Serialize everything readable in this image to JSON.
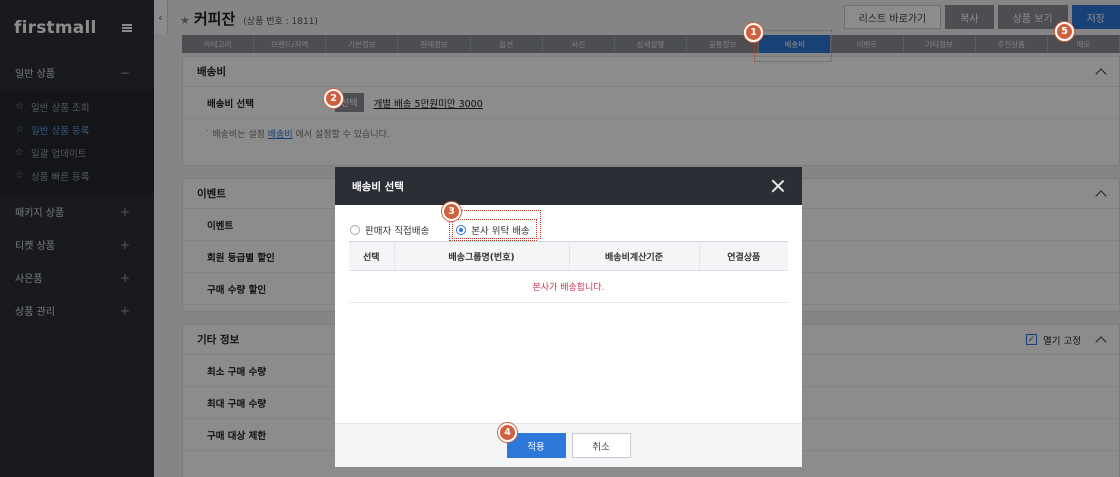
{
  "sidebar": {
    "brand": "firstmall",
    "groups": [
      {
        "label": "일반 상품",
        "sign": "−"
      },
      {
        "label": "패키지 상품",
        "sign": "+"
      },
      {
        "label": "티켓 상품",
        "sign": "+"
      },
      {
        "label": "사은품",
        "sign": "+"
      },
      {
        "label": "상품 관리",
        "sign": "+"
      }
    ],
    "submenu": [
      "일반 상품 조회",
      "일반 상품 등록",
      "일괄 업데이트",
      "상품 빠른 등록"
    ]
  },
  "header": {
    "title": "커피잔",
    "product_no": "(상품 번호 : 1811)",
    "buttons": {
      "list": "리스트 바로가기",
      "copy": "복사",
      "view": "상품 보기",
      "save": "저장"
    }
  },
  "tabs": [
    "카테고리",
    "브랜드/지역",
    "기본정보",
    "판매정보",
    "옵션",
    "사진",
    "상세설명",
    "공통정보",
    "배송비",
    "이벤트",
    "기타정보",
    "추천상품",
    "메모"
  ],
  "shipping_panel": {
    "title": "배송비",
    "row_label": "배송비 선택",
    "select_btn": "선택",
    "link": "개별 배송 5만원미만 3000",
    "note_pre": "배송비는 설정",
    "note_link": "배송비",
    "note_post": "에서 설정할 수 있습니다."
  },
  "event_panel": {
    "title": "이벤트",
    "rows": [
      "이벤트",
      "회원 등급별 할인",
      "구매 수량 할인"
    ]
  },
  "etc_panel": {
    "title": "기타 정보",
    "fix_label": "열기 고정",
    "rows": [
      "최소 구매 수량",
      "최대 구매 수량",
      "구매 대상 제한"
    ]
  },
  "modal": {
    "title": "배송비 선택",
    "radio_seller": "판매자 직접배송",
    "radio_hq": "본사 위탁 배송",
    "columns": [
      "선택",
      "배송그룹명(번호)",
      "배송비계산기준",
      "연결상품"
    ],
    "empty_msg": "본사가 배송합니다.",
    "apply": "적용",
    "cancel": "취소"
  },
  "callouts": [
    "1",
    "2",
    "3",
    "4",
    "5"
  ],
  "colors": {
    "accent": "#2d77d8",
    "callout": "#d0603f",
    "sidebar": "#2d3038"
  }
}
